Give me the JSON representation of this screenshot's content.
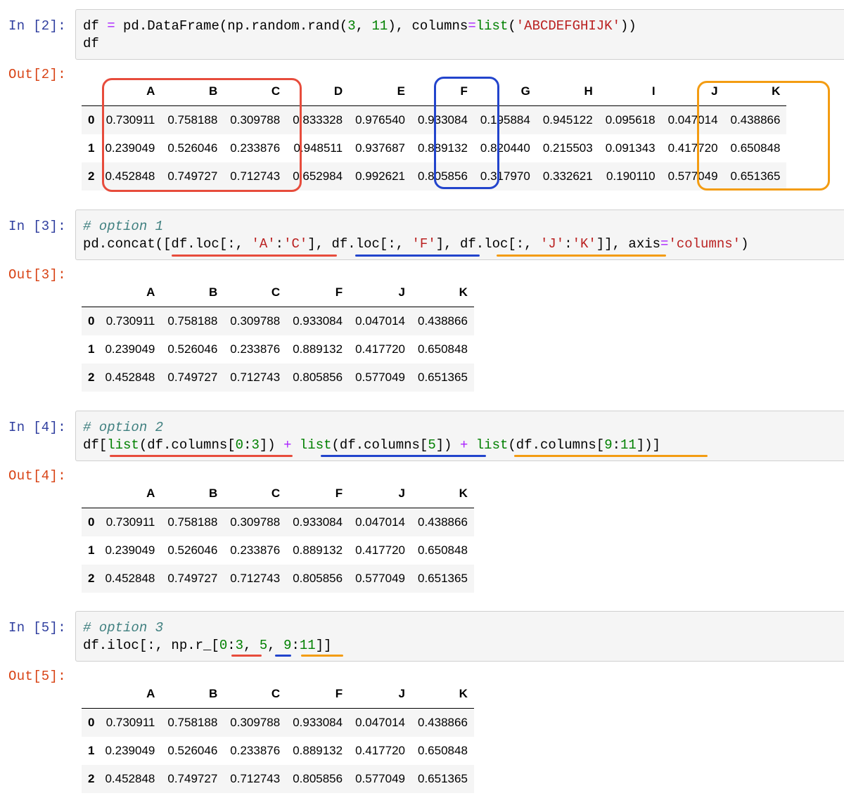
{
  "cells": [
    {
      "in_prompt": "In [2]:",
      "out_prompt": "Out[2]:",
      "code_lines": [
        [
          {
            "t": "df "
          },
          {
            "t": "=",
            "c": "op"
          },
          {
            "t": " pd.DataFrame(np.random.rand("
          },
          {
            "t": "3",
            "c": "num"
          },
          {
            "t": ", "
          },
          {
            "t": "11",
            "c": "num"
          },
          {
            "t": "), columns"
          },
          {
            "t": "=",
            "c": "op"
          },
          {
            "t": "list",
            "c": "bi"
          },
          {
            "t": "("
          },
          {
            "t": "'ABCDEFGHIJK'",
            "c": "str"
          },
          {
            "t": "))"
          }
        ],
        [
          {
            "t": "df"
          }
        ]
      ],
      "table": {
        "columns": [
          "A",
          "B",
          "C",
          "D",
          "E",
          "F",
          "G",
          "H",
          "I",
          "J",
          "K"
        ],
        "rows": [
          {
            "index": "0",
            "values": [
              "0.730911",
              "0.758188",
              "0.309788",
              "0.833328",
              "0.976540",
              "0.933084",
              "0.195884",
              "0.945122",
              "0.095618",
              "0.047014",
              "0.438866"
            ]
          },
          {
            "index": "1",
            "values": [
              "0.239049",
              "0.526046",
              "0.233876",
              "0.948511",
              "0.937687",
              "0.889132",
              "0.820440",
              "0.215503",
              "0.091343",
              "0.417720",
              "0.650848"
            ]
          },
          {
            "index": "2",
            "values": [
              "0.452848",
              "0.749727",
              "0.712743",
              "0.652984",
              "0.992621",
              "0.805856",
              "0.317970",
              "0.332621",
              "0.190110",
              "0.577049",
              "0.651365"
            ]
          }
        ]
      }
    },
    {
      "in_prompt": "In [3]:",
      "out_prompt": "Out[3]:",
      "code_lines": [
        [
          {
            "t": "# option 1",
            "c": "cm"
          }
        ],
        [
          {
            "t": "pd.concat([df.loc[:, "
          },
          {
            "t": "'A'",
            "c": "str"
          },
          {
            "t": ":"
          },
          {
            "t": "'C'",
            "c": "str"
          },
          {
            "t": "], df.loc[:, "
          },
          {
            "t": "'F'",
            "c": "str"
          },
          {
            "t": "], df.loc[:, "
          },
          {
            "t": "'J'",
            "c": "str"
          },
          {
            "t": ":"
          },
          {
            "t": "'K'",
            "c": "str"
          },
          {
            "t": "]], axis"
          },
          {
            "t": "=",
            "c": "op"
          },
          {
            "t": "'columns'",
            "c": "str"
          },
          {
            "t": ")"
          }
        ]
      ],
      "table": {
        "columns": [
          "A",
          "B",
          "C",
          "F",
          "J",
          "K"
        ],
        "rows": [
          {
            "index": "0",
            "values": [
              "0.730911",
              "0.758188",
              "0.309788",
              "0.933084",
              "0.047014",
              "0.438866"
            ]
          },
          {
            "index": "1",
            "values": [
              "0.239049",
              "0.526046",
              "0.233876",
              "0.889132",
              "0.417720",
              "0.650848"
            ]
          },
          {
            "index": "2",
            "values": [
              "0.452848",
              "0.749727",
              "0.712743",
              "0.805856",
              "0.577049",
              "0.651365"
            ]
          }
        ]
      }
    },
    {
      "in_prompt": "In [4]:",
      "out_prompt": "Out[4]:",
      "code_lines": [
        [
          {
            "t": "# option 2",
            "c": "cm"
          }
        ],
        [
          {
            "t": "df["
          },
          {
            "t": "list",
            "c": "bi"
          },
          {
            "t": "(df.columns["
          },
          {
            "t": "0",
            "c": "num"
          },
          {
            "t": ":"
          },
          {
            "t": "3",
            "c": "num"
          },
          {
            "t": "]) "
          },
          {
            "t": "+",
            "c": "op"
          },
          {
            "t": " "
          },
          {
            "t": "list",
            "c": "bi"
          },
          {
            "t": "(df.columns["
          },
          {
            "t": "5",
            "c": "num"
          },
          {
            "t": "]) "
          },
          {
            "t": "+",
            "c": "op"
          },
          {
            "t": " "
          },
          {
            "t": "list",
            "c": "bi"
          },
          {
            "t": "(df.columns["
          },
          {
            "t": "9",
            "c": "num"
          },
          {
            "t": ":"
          },
          {
            "t": "11",
            "c": "num"
          },
          {
            "t": "])]"
          }
        ]
      ],
      "table": {
        "columns": [
          "A",
          "B",
          "C",
          "F",
          "J",
          "K"
        ],
        "rows": [
          {
            "index": "0",
            "values": [
              "0.730911",
              "0.758188",
              "0.309788",
              "0.933084",
              "0.047014",
              "0.438866"
            ]
          },
          {
            "index": "1",
            "values": [
              "0.239049",
              "0.526046",
              "0.233876",
              "0.889132",
              "0.417720",
              "0.650848"
            ]
          },
          {
            "index": "2",
            "values": [
              "0.452848",
              "0.749727",
              "0.712743",
              "0.805856",
              "0.577049",
              "0.651365"
            ]
          }
        ]
      }
    },
    {
      "in_prompt": "In [5]:",
      "out_prompt": "Out[5]:",
      "code_lines": [
        [
          {
            "t": "# option 3",
            "c": "cm"
          }
        ],
        [
          {
            "t": "df.iloc[:, np.r_["
          },
          {
            "t": "0",
            "c": "num"
          },
          {
            "t": ":"
          },
          {
            "t": "3",
            "c": "num"
          },
          {
            "t": ", "
          },
          {
            "t": "5",
            "c": "num"
          },
          {
            "t": ", "
          },
          {
            "t": "9",
            "c": "num"
          },
          {
            "t": ":"
          },
          {
            "t": "11",
            "c": "num"
          },
          {
            "t": "]]"
          }
        ]
      ],
      "table": {
        "columns": [
          "A",
          "B",
          "C",
          "F",
          "J",
          "K"
        ],
        "rows": [
          {
            "index": "0",
            "values": [
              "0.730911",
              "0.758188",
              "0.309788",
              "0.933084",
              "0.047014",
              "0.438866"
            ]
          },
          {
            "index": "1",
            "values": [
              "0.239049",
              "0.526046",
              "0.233876",
              "0.889132",
              "0.417720",
              "0.650848"
            ]
          },
          {
            "index": "2",
            "values": [
              "0.452848",
              "0.749727",
              "0.712743",
              "0.805856",
              "0.577049",
              "0.651365"
            ]
          }
        ]
      }
    }
  ],
  "highlight_colors": {
    "red": "#e74c3c",
    "blue": "#2244cc",
    "orange": "#f39c12"
  }
}
